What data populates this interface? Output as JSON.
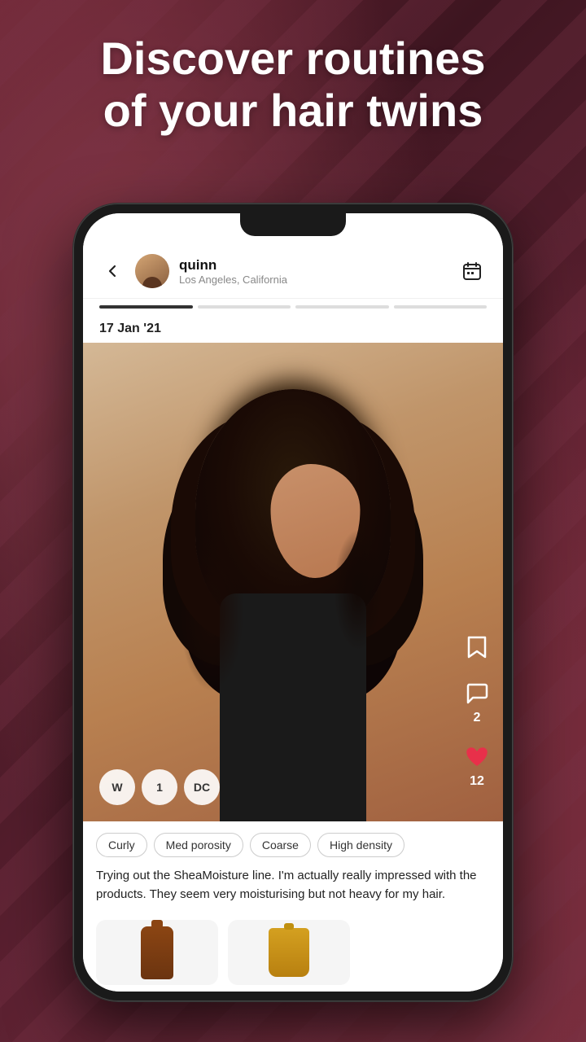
{
  "hero": {
    "title_line1": "Discover routines",
    "title_line2": "of your hair twins"
  },
  "header": {
    "back_label": "←",
    "username": "quinn",
    "location": "Los Angeles, California",
    "calendar_icon": "calendar-icon"
  },
  "progress": {
    "bars": [
      {
        "state": "active"
      },
      {
        "state": "inactive"
      },
      {
        "state": "inactive"
      },
      {
        "state": "inactive"
      }
    ]
  },
  "post": {
    "date": "17 Jan '21",
    "badges": [
      "W",
      "1",
      "DC"
    ],
    "tags": [
      "Curly",
      "Med porosity",
      "Coarse",
      "High density"
    ],
    "description": "Trying out the SheaMoisture line. I'm actually really impressed with the products. They seem very moisturising but not heavy for my hair.",
    "actions": {
      "bookmark_icon": "bookmark-icon",
      "comment_icon": "comment-icon",
      "comment_count": "2",
      "heart_icon": "heart-icon",
      "heart_count": "12"
    }
  },
  "products": [
    {
      "type": "bottle",
      "label": "product-1"
    },
    {
      "type": "tube",
      "label": "product-2"
    }
  ]
}
